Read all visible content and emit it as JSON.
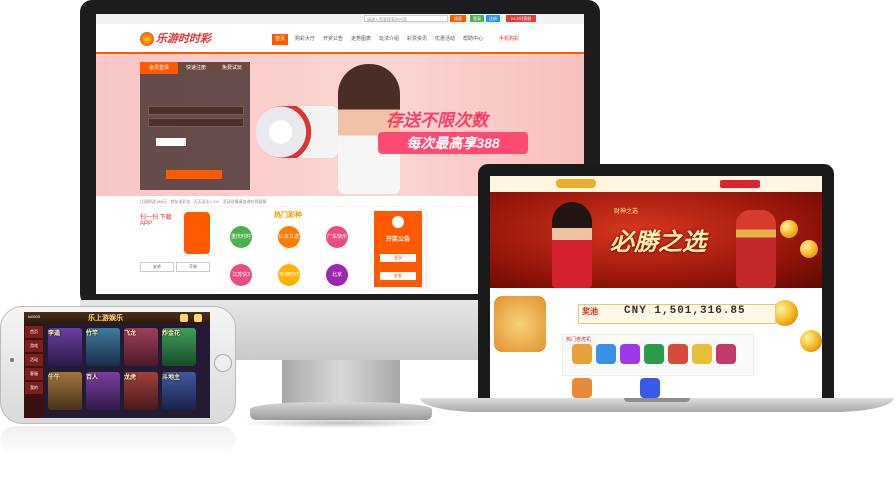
{
  "desktop": {
    "top_bar": {
      "search_placeholder": "请输入您要搜索的内容",
      "btn_search": "搜索",
      "btn_login": "登录",
      "btn_register": "注册",
      "btn_service": "24小时客服"
    },
    "logo_text": "乐游时时彩",
    "nav": [
      "首页",
      "购彩大厅",
      "开奖公告",
      "走势图表",
      "玩法介绍",
      "彩票资讯",
      "优惠活动",
      "帮助中心",
      "手机购彩"
    ],
    "login_tabs": [
      "会员登录",
      "快速注册",
      "免费试玩"
    ],
    "banner_promo": "存送不限次数",
    "banner_promo2": "每次最高享388",
    "news_ticker": "注册即送188元 · 首存送彩金 · 天天返水1.2% · 活动详情请咨询在线客服",
    "qr_text": "扫一扫 下载APP",
    "qr_buttons": [
      "安卓",
      "苹果"
    ],
    "hot_title": "热门彩种",
    "lottery_circles": [
      "重庆时时彩",
      "山东11选5",
      "广东快乐十分",
      "北京PK10",
      "江苏快3",
      "天津时时彩"
    ],
    "notice_title": "开奖公告",
    "notice_more": "更多",
    "notice_btn": "查看"
  },
  "laptop": {
    "banner_subtitle": "财神之选",
    "banner_title": "必勝之选",
    "jackpot_label": "奖池",
    "jackpot_value": "CNY 1,501,316.85",
    "hot_games_title": "热门老虎机"
  },
  "phone": {
    "title": "乐上游娱乐",
    "user": "lu0603",
    "side_items": [
      "首页",
      "游戏",
      "活动",
      "客服",
      "我的"
    ],
    "cards": [
      "李逵",
      "竹竿",
      "飞龙",
      "牛牛",
      "百人",
      "龙虎",
      "炸金花",
      "斗地主"
    ]
  },
  "colors": {
    "accent": "#ff5a00",
    "promo_pink": "#ff4b74",
    "laptop_red": "#b01d0e",
    "gold": "#f2b418"
  }
}
